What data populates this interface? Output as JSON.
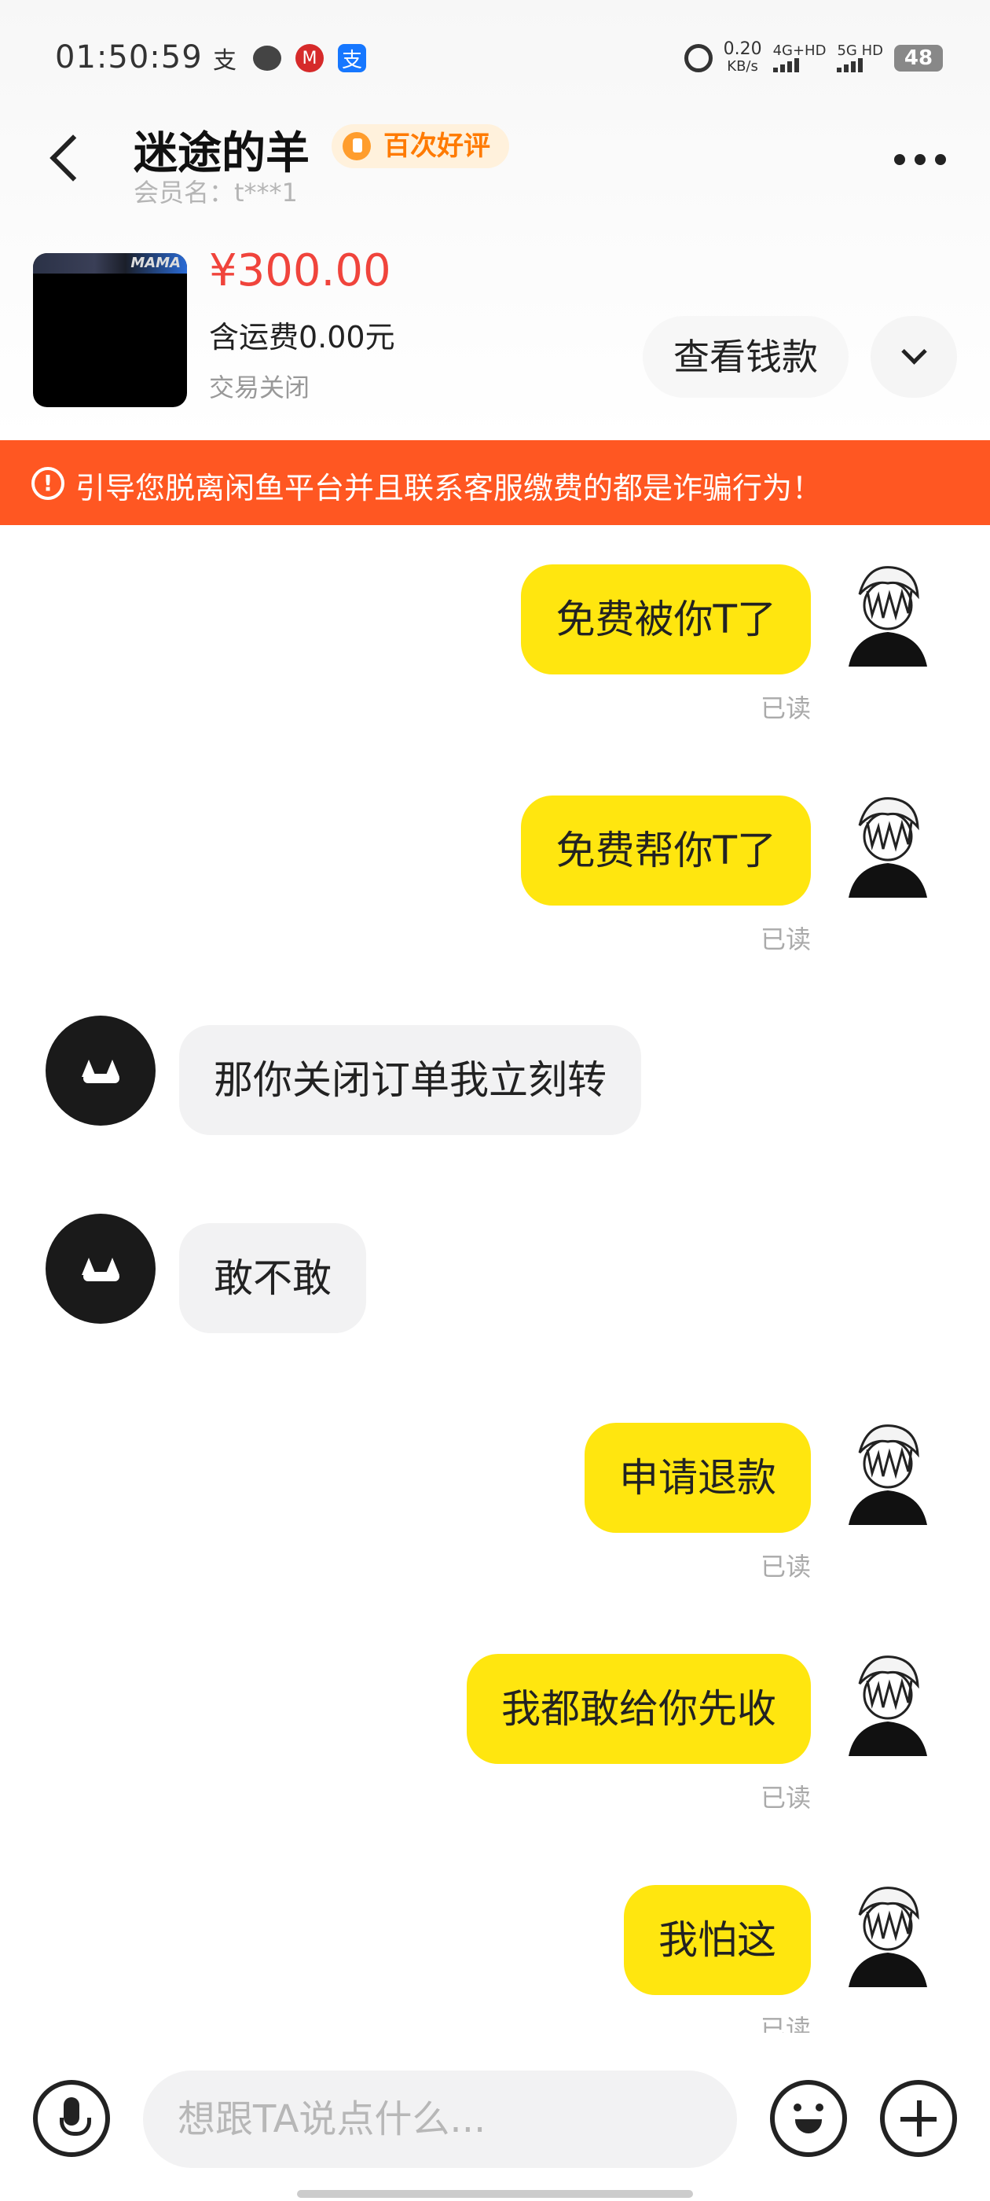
{
  "status_bar": {
    "time": "01:50:59",
    "net_speed": "0.20",
    "net_speed_unit": "KB/s",
    "network_1": "4G+HD",
    "network_2": "5G HD",
    "battery": "48"
  },
  "header": {
    "seller_name": "迷途的羊",
    "badge": "百次好评",
    "member_label": "会员名：t***1"
  },
  "product": {
    "thumb_text": "MAMA",
    "price": "¥300.00",
    "shipping": "含运费0.00元",
    "status": "交易关闭",
    "view_button": "查看钱款"
  },
  "warning": {
    "icon": "!",
    "text": "引导您脱离闲鱼平台并且联系客服缴费的都是诈骗行为！"
  },
  "messages": [
    {
      "sender": "me",
      "text": "免费被你T了",
      "status": "已读"
    },
    {
      "sender": "me",
      "text": "免费帮你T了",
      "status": "已读"
    },
    {
      "sender": "them",
      "text": "那你关闭订单我立刻转"
    },
    {
      "sender": "them",
      "text": "敢不敢"
    },
    {
      "sender": "me",
      "text": "申请退款",
      "status": "已读"
    },
    {
      "sender": "me",
      "text": "我都敢给你先收",
      "status": "已读"
    },
    {
      "sender": "me",
      "text": "我怕这",
      "status": "已读"
    }
  ],
  "input": {
    "placeholder": "想跟TA说点什么..."
  },
  "colors": {
    "accent_yellow": "#ffe60f",
    "warning_orange": "#ff5722",
    "price_red": "#f0443c"
  }
}
